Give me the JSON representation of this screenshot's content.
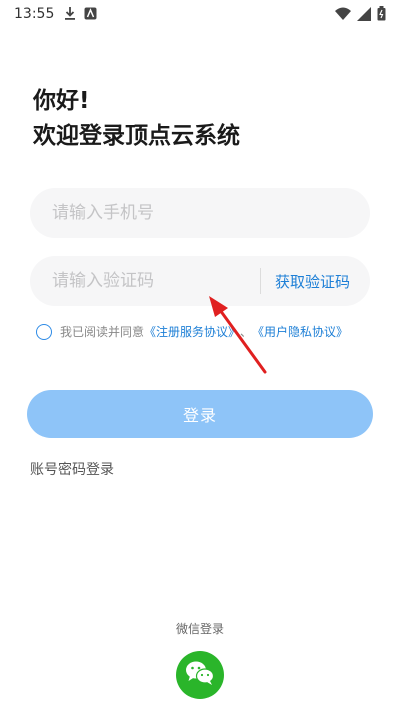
{
  "status_bar": {
    "time": "13:55",
    "icons": [
      "download-icon",
      "app-notification-icon",
      "wifi-icon",
      "signal-icon",
      "battery-icon"
    ]
  },
  "greeting": {
    "line1": "你好!",
    "line2": "欢迎登录顶点云系统"
  },
  "phone_input": {
    "placeholder": "请输入手机号",
    "value": ""
  },
  "code_input": {
    "placeholder": "请输入验证码",
    "value": ""
  },
  "get_code_label": "获取验证码",
  "agreement": {
    "prefix": "我已阅读并同意",
    "service_link": "《注册服务协议》",
    "separator": "、",
    "privacy_link": "《用户隐私协议》",
    "checked": false
  },
  "login_button": "登录",
  "password_login": "账号密码登录",
  "wechat": {
    "label": "微信登录",
    "icon": "wechat-icon"
  },
  "colors": {
    "accent": "#1d7fd6",
    "login_button": "#8ec4f8",
    "wechat": "#2ab52a",
    "annotation_arrow": "#e02020"
  }
}
